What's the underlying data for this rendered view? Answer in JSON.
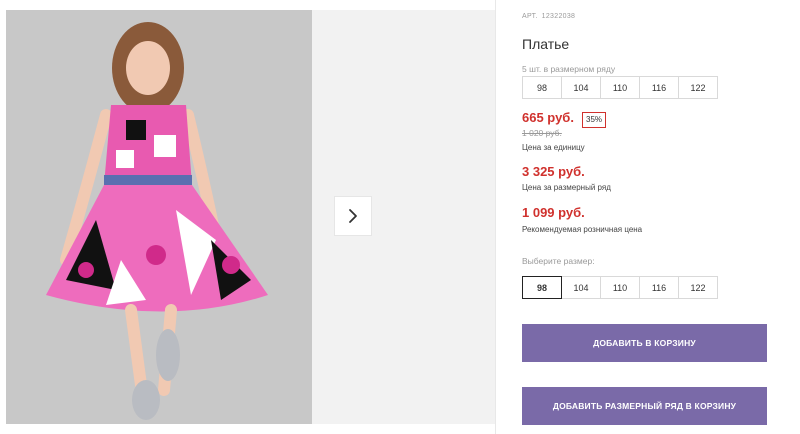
{
  "gallery": {
    "photo_alt": "Платье",
    "next_icon": "chevron-right-icon"
  },
  "product": {
    "art_label": "АРТ.",
    "art_number": "12322038",
    "title": "Платье",
    "row_note": "5 шт. в размерном ряду",
    "row_sizes": [
      "98",
      "104",
      "110",
      "116",
      "122"
    ],
    "price": "665 руб.",
    "discount": "35%",
    "old_price": "1 020 руб.",
    "price_label": "Цена за единицу",
    "row_price": "3 325 руб.",
    "row_price_label": "Цена за размерный ряд",
    "retail_price": "1 099 руб.",
    "retail_price_label": "Рекомендуемая розничная цена",
    "choose_size_label": "Выберите размер:",
    "sizes": [
      "98",
      "104",
      "110",
      "116",
      "122"
    ],
    "selected_size": "98"
  },
  "actions": {
    "add_to_cart": "ДОБАВИТЬ В КОРЗИНУ",
    "add_row_to_cart": "ДОБАВИТЬ РАЗМЕРНЫЙ РЯД В КОРЗИНУ"
  },
  "colors": {
    "accent": "#7a6aa8",
    "price": "#d0312d"
  }
}
